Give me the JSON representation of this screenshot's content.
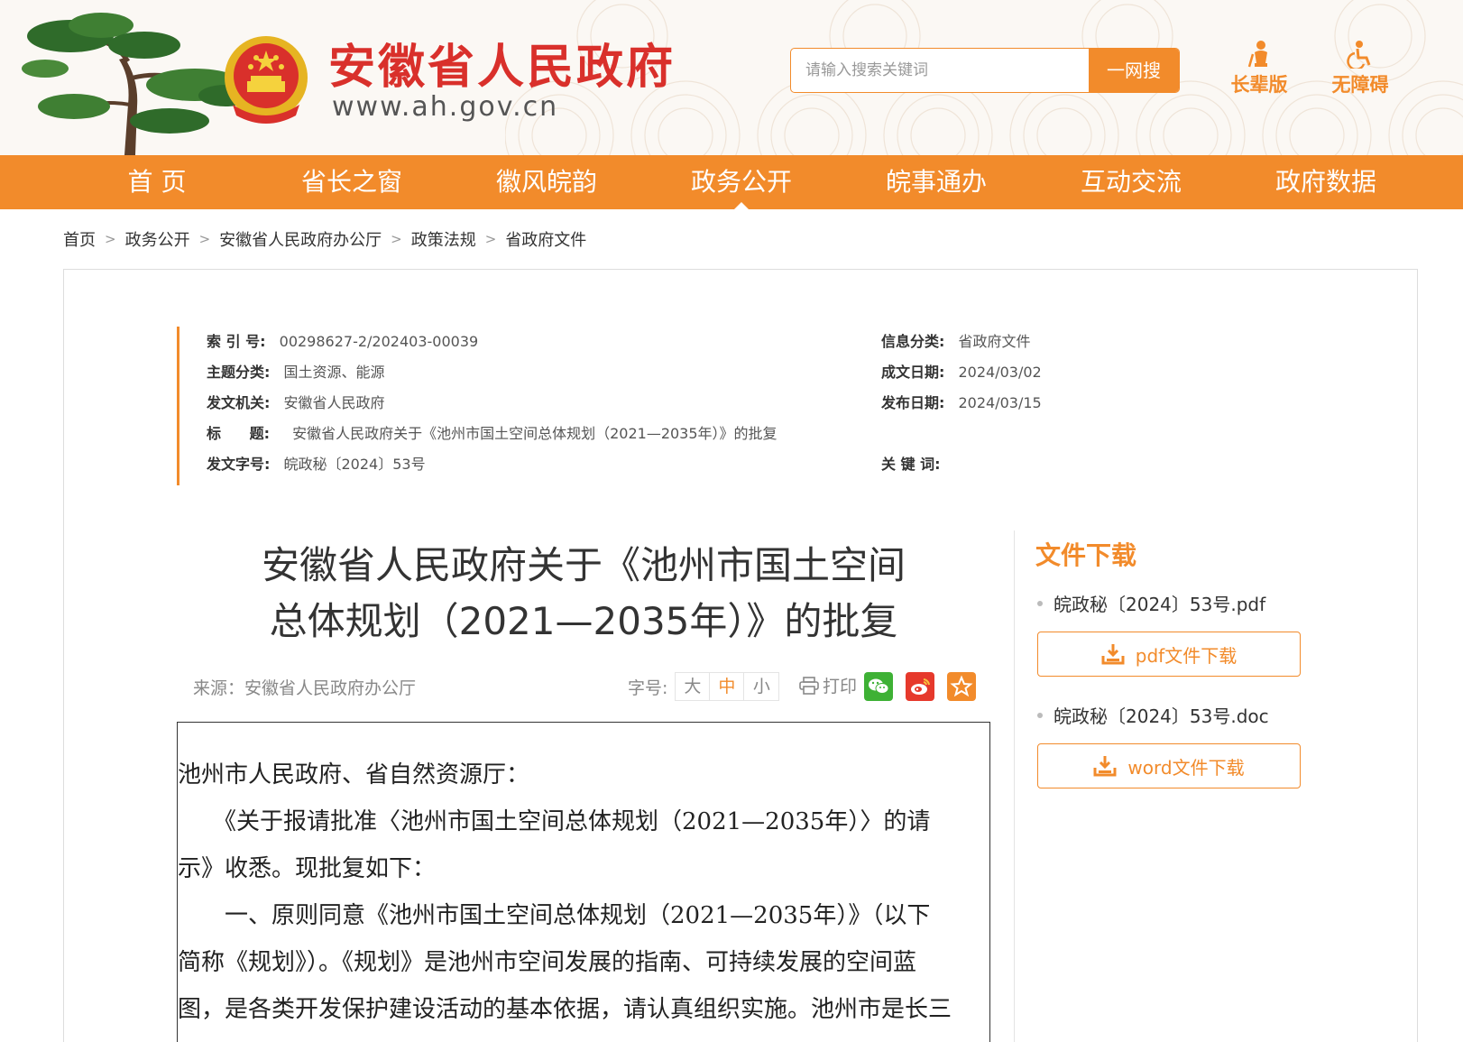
{
  "header": {
    "site_title": "安徽省人民政府",
    "site_url": "www.ah.gov.cn",
    "search": {
      "placeholder": "请输入搜索关键词",
      "button": "一网搜"
    },
    "tools": [
      {
        "label": "长辈版",
        "icon": "elder-icon"
      },
      {
        "label": "无障碍",
        "icon": "accessibility-icon"
      }
    ]
  },
  "nav": {
    "items": [
      "首 页",
      "省长之窗",
      "徽风皖韵",
      "政务公开",
      "皖事通办",
      "互动交流",
      "政府数据"
    ],
    "active": "政务公开"
  },
  "breadcrumb": [
    "首页",
    "政务公开",
    "安徽省人民政府办公厅",
    "政策法规",
    "省政府文件"
  ],
  "meta": {
    "index_label": "索 引 号:",
    "index_value": "00298627-2/202403-00039",
    "category_label": "信息分类:",
    "category_value": "省政府文件",
    "topic_label": "主题分类:",
    "topic_value": "国土资源、能源",
    "created_label": "成文日期:",
    "created_value": "2024/03/02",
    "issuer_label": "发文机关:",
    "issuer_value": "安徽省人民政府",
    "published_label": "发布日期:",
    "published_value": "2024/03/15",
    "title_label": "标 题:",
    "title_value": "安徽省人民政府关于《池州市国土空间总体规划（2021—2035年）》的批复",
    "doc_no_label": "发文字号:",
    "doc_no_value": "皖政秘〔2024〕53号",
    "keywords_label": "关 键 词:"
  },
  "article": {
    "title_line1": "安徽省人民政府关于《池州市国土空间",
    "title_line2": "总体规划（2021—2035年）》的批复",
    "source": "来源：安徽省人民政府办公厅",
    "font_size_label": "字号:",
    "font_sizes": [
      "大",
      "中",
      "小"
    ],
    "font_size_active": "中",
    "print_label": "打印",
    "share": [
      "wechat-icon",
      "weibo-icon",
      "favorite-icon"
    ],
    "paragraphs": [
      "池州市人民政府、省自然资源厅：",
      "　　《关于报请批准〈池州市国土空间总体规划（2021—2035年）〉的请",
      "示》收悉。现批复如下：",
      "　　一、原则同意《池州市国土空间总体规划（2021—2035年）》（以下",
      "简称《规划》）。《规划》是池州市空间发展的指南、可持续发展的空间蓝",
      "图，是各类开发保护建设活动的基本依据，请认真组织实施。池州市是长三"
    ]
  },
  "sidebar": {
    "title": "文件下载",
    "files": [
      {
        "name": "皖政秘〔2024〕53号.pdf",
        "button": "pdf文件下载"
      },
      {
        "name": "皖政秘〔2024〕53号.doc",
        "button": "word文件下载"
      }
    ]
  },
  "colors": {
    "accent": "#f28b2b",
    "title_red": "#d9302b"
  }
}
